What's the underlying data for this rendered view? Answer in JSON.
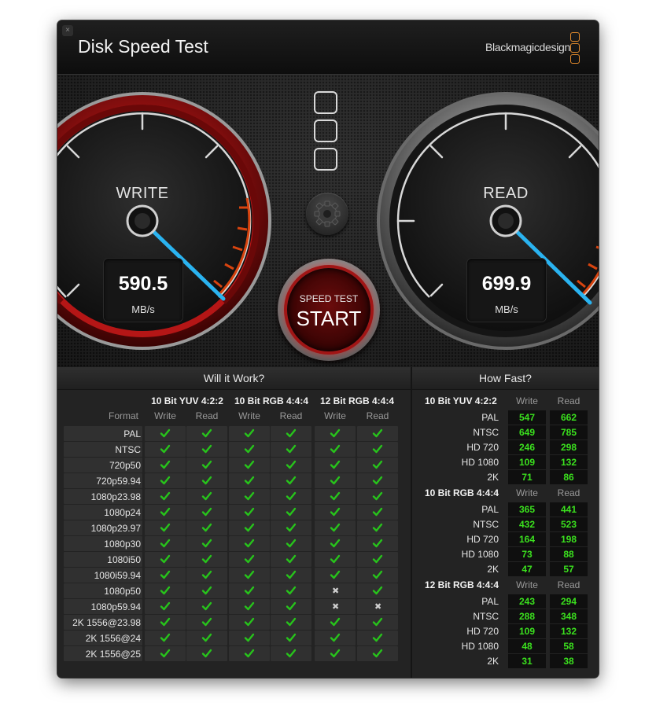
{
  "window": {
    "title": "Disk Speed Test",
    "brand": "Blackmagicdesign",
    "close_glyph": "×"
  },
  "accent_colors": {
    "start_red": "#a11515",
    "needle": "#2ab3f0",
    "value_green": "#3be11e",
    "logo_orange": "#e0892c"
  },
  "write_gauge": {
    "label": "WRITE",
    "value": "590.5",
    "unit": "MB/s"
  },
  "read_gauge": {
    "label": "READ",
    "value": "699.9",
    "unit": "MB/s"
  },
  "start_button": {
    "subtitle": "SPEED TEST",
    "label": "START"
  },
  "will_it_work": {
    "title": "Will it Work?",
    "format_header": "Format",
    "groups": [
      "10 Bit YUV 4:2:2",
      "10 Bit RGB 4:4:4",
      "12 Bit RGB 4:4:4"
    ],
    "sub_headers": [
      "Write",
      "Read",
      "Write",
      "Read",
      "Write",
      "Read"
    ],
    "rows": [
      {
        "format": "PAL",
        "results": [
          1,
          1,
          1,
          1,
          1,
          1
        ]
      },
      {
        "format": "NTSC",
        "results": [
          1,
          1,
          1,
          1,
          1,
          1
        ]
      },
      {
        "format": "720p50",
        "results": [
          1,
          1,
          1,
          1,
          1,
          1
        ]
      },
      {
        "format": "720p59.94",
        "results": [
          1,
          1,
          1,
          1,
          1,
          1
        ]
      },
      {
        "format": "1080p23.98",
        "results": [
          1,
          1,
          1,
          1,
          1,
          1
        ]
      },
      {
        "format": "1080p24",
        "results": [
          1,
          1,
          1,
          1,
          1,
          1
        ]
      },
      {
        "format": "1080p29.97",
        "results": [
          1,
          1,
          1,
          1,
          1,
          1
        ]
      },
      {
        "format": "1080p30",
        "results": [
          1,
          1,
          1,
          1,
          1,
          1
        ]
      },
      {
        "format": "1080i50",
        "results": [
          1,
          1,
          1,
          1,
          1,
          1
        ]
      },
      {
        "format": "1080i59.94",
        "results": [
          1,
          1,
          1,
          1,
          1,
          1
        ]
      },
      {
        "format": "1080p50",
        "results": [
          1,
          1,
          1,
          1,
          0,
          1
        ]
      },
      {
        "format": "1080p59.94",
        "results": [
          1,
          1,
          1,
          1,
          0,
          0
        ]
      },
      {
        "format": "2K 1556@23.98",
        "results": [
          1,
          1,
          1,
          1,
          1,
          1
        ]
      },
      {
        "format": "2K 1556@24",
        "results": [
          1,
          1,
          1,
          1,
          1,
          1
        ]
      },
      {
        "format": "2K 1556@25",
        "results": [
          1,
          1,
          1,
          1,
          1,
          1
        ]
      }
    ]
  },
  "how_fast": {
    "title": "How Fast?",
    "write_header": "Write",
    "read_header": "Read",
    "groups": [
      {
        "name": "10 Bit YUV 4:2:2",
        "rows": [
          {
            "format": "PAL",
            "write": "547",
            "read": "662"
          },
          {
            "format": "NTSC",
            "write": "649",
            "read": "785"
          },
          {
            "format": "HD 720",
            "write": "246",
            "read": "298"
          },
          {
            "format": "HD 1080",
            "write": "109",
            "read": "132"
          },
          {
            "format": "2K",
            "write": "71",
            "read": "86"
          }
        ]
      },
      {
        "name": "10 Bit RGB 4:4:4",
        "rows": [
          {
            "format": "PAL",
            "write": "365",
            "read": "441"
          },
          {
            "format": "NTSC",
            "write": "432",
            "read": "523"
          },
          {
            "format": "HD 720",
            "write": "164",
            "read": "198"
          },
          {
            "format": "HD 1080",
            "write": "73",
            "read": "88"
          },
          {
            "format": "2K",
            "write": "47",
            "read": "57"
          }
        ]
      },
      {
        "name": "12 Bit RGB 4:4:4",
        "rows": [
          {
            "format": "PAL",
            "write": "243",
            "read": "294"
          },
          {
            "format": "NTSC",
            "write": "288",
            "read": "348"
          },
          {
            "format": "HD 720",
            "write": "109",
            "read": "132"
          },
          {
            "format": "HD 1080",
            "write": "48",
            "read": "58"
          },
          {
            "format": "2K",
            "write": "31",
            "read": "38"
          }
        ]
      }
    ]
  }
}
